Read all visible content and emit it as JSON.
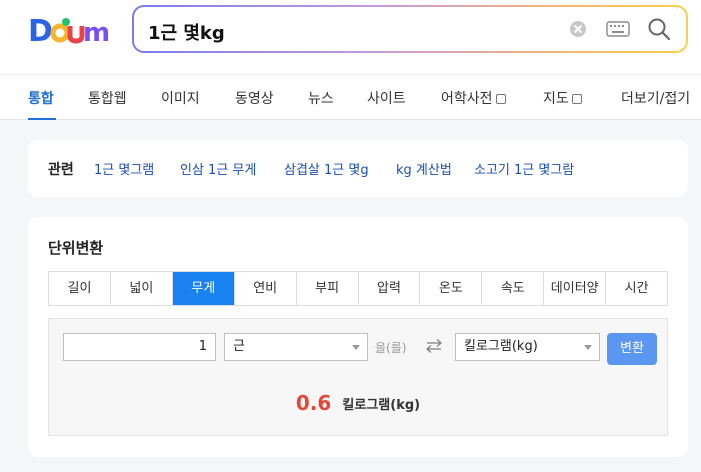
{
  "logo": {
    "text": "Daum",
    "colors": [
      "#2a62e8",
      "#f7b52b",
      "#23c16b",
      "#e8424a",
      "#7a4ef0"
    ]
  },
  "search": {
    "query": "1근 몇kg"
  },
  "icons": {
    "clear": "clear-icon",
    "keyboard": "keyboard-icon",
    "search": "search-icon",
    "swap": "swap-icon",
    "external": "external-window-icon"
  },
  "tabs": [
    {
      "label": "통합",
      "active": true
    },
    {
      "label": "통합웹"
    },
    {
      "label": "이미지"
    },
    {
      "label": "동영상"
    },
    {
      "label": "뉴스"
    },
    {
      "label": "사이트"
    },
    {
      "label": "어학사전",
      "external": true
    },
    {
      "label": "지도",
      "external": true
    },
    {
      "label": "더보기/접기"
    }
  ],
  "related": {
    "label": "관련",
    "links": [
      "1근 몇그램",
      "인삼 1근 무게",
      "삼겹살 1근 몇g",
      "kg 계산법",
      "소고기 1근 몇그람"
    ]
  },
  "converter": {
    "title": "단위변환",
    "tabs": [
      "길이",
      "넓이",
      "무게",
      "연비",
      "부피",
      "압력",
      "온도",
      "속도",
      "데이터양",
      "시간"
    ],
    "active_tab": "무게",
    "input_value": "1",
    "from_unit": "근",
    "particle": "을(를)",
    "to_unit": "킬로그램(kg)",
    "convert_label": "변환",
    "result_value": "0.6",
    "result_unit": "킬로그램(kg)"
  },
  "colors": {
    "accent": "#1f6fd6",
    "active_tab_bg": "#1a82f0",
    "result": "#e2493b",
    "button": "#5b97f0",
    "link": "#1a4fb5"
  }
}
